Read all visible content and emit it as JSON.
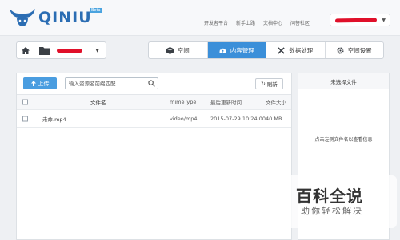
{
  "app": {
    "logo_text": "QINIU",
    "logo_badge": "Beta"
  },
  "topnav": [
    "开发者平台",
    "新手上路",
    "文档中心",
    "问答社区"
  ],
  "toolbar": {
    "tabs": [
      {
        "label": "空间",
        "icon": "cube-icon",
        "active": false
      },
      {
        "label": "内容管理",
        "icon": "cloud-upload-icon",
        "active": true
      },
      {
        "label": "数据处理",
        "icon": "tools-icon",
        "active": false
      },
      {
        "label": "空间设置",
        "icon": "gear-icon",
        "active": false
      }
    ]
  },
  "main": {
    "upload_label": "上传",
    "search_placeholder": "输入资源名前缀匹配",
    "refresh_label": "刷新",
    "columns": {
      "name": "文件名",
      "mime": "mimeType",
      "time": "最后更新时间",
      "size": "文件大小"
    },
    "rows": [
      {
        "name": "未命.mp4",
        "mime": "video/mp4",
        "time": "2015-07-29 10:24:00",
        "size": "40 MB"
      }
    ]
  },
  "side": {
    "title": "未选择文件",
    "hint": "点击左侧文件名以查看信息"
  },
  "watermark": {
    "title": "百科全说",
    "subtitle": "助你轻松解决"
  },
  "colors": {
    "accent": "#3b8fd9",
    "brand": "#2b6db3",
    "redaction": "#e0102a"
  }
}
